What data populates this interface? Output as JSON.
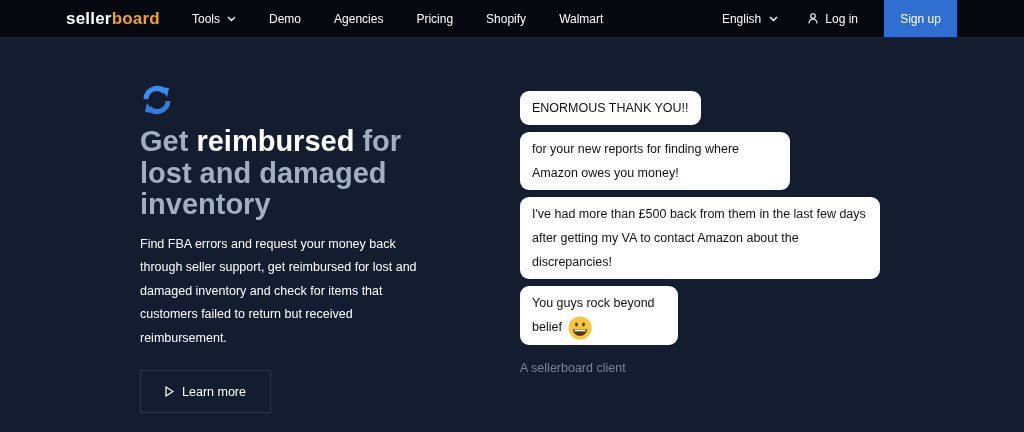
{
  "nav": {
    "logo": {
      "part_1": "seller",
      "part_2": "board"
    },
    "links": [
      {
        "label": "Tools",
        "dropdown": true
      },
      {
        "label": "Demo",
        "dropdown": false
      },
      {
        "label": "Agencies",
        "dropdown": false
      },
      {
        "label": "Pricing",
        "dropdown": false
      },
      {
        "label": "Shopify",
        "dropdown": false
      },
      {
        "label": "Walmart",
        "dropdown": false
      }
    ],
    "language": "English",
    "login": "Log in",
    "signup": "Sign up"
  },
  "hero": {
    "heading": "Get **reimbursed** for lost and damaged inventory",
    "description": "Find FBA errors and request your money back through seller support, get reimbursed for lost and damaged inventory and check for items that customers failed to return but received reimbursement.",
    "button": "Learn more"
  },
  "testimonial": {
    "messages": [
      {
        "text": "ENORMOUS THANK YOU!!"
      },
      {
        "text": "for your new reports for finding where Amazon owes you money!"
      },
      {
        "text": "I've had more than £500 back from them in the last few days after getting my VA to contact Amazon about the discrepancies!"
      },
      {
        "text": "You guys rock beyond belief",
        "emoji": true
      }
    ],
    "author": "A sellerboard client"
  }
}
